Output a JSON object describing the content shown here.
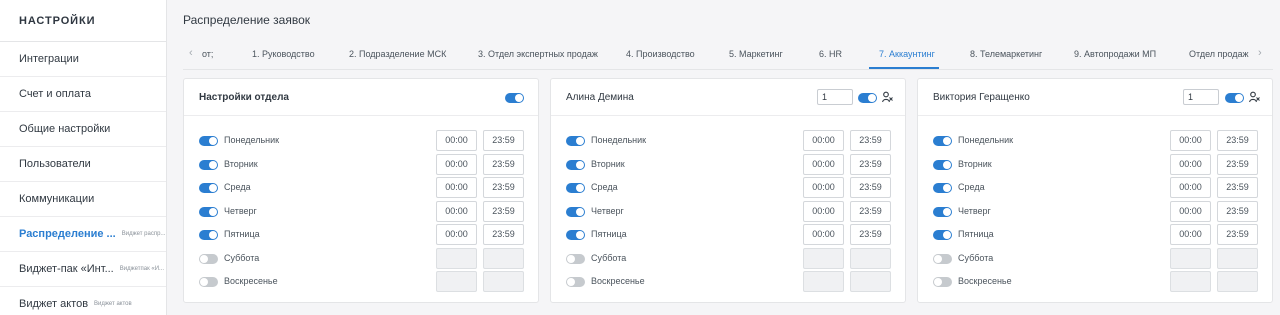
{
  "sidebar": {
    "title": "НАСТРОЙКИ",
    "items": [
      {
        "label": "Интеграции",
        "sub": ""
      },
      {
        "label": "Счет и оплата",
        "sub": ""
      },
      {
        "label": "Общие настройки",
        "sub": ""
      },
      {
        "label": "Пользователи",
        "sub": ""
      },
      {
        "label": "Коммуникации",
        "sub": ""
      },
      {
        "label": "Распределение ...",
        "sub": "Виджет распр...",
        "active": true
      },
      {
        "label": "Виджет-пак «Инт...",
        "sub": "Виджетпак «И..."
      },
      {
        "label": "Виджет актов",
        "sub": "Виджет актов"
      }
    ]
  },
  "header": {
    "title": "Распределение заявок"
  },
  "tabs": [
    {
      "label": "от;"
    },
    {
      "label": "1. Руководство"
    },
    {
      "label": "2. Подразделение МСК"
    },
    {
      "label": "3. Отдел экспертных продаж"
    },
    {
      "label": "4. Производство"
    },
    {
      "label": "5. Маркетинг"
    },
    {
      "label": "6. HR"
    },
    {
      "label": "7. Аккаунтинг",
      "active": true
    },
    {
      "label": "8. Телемаркетинг"
    },
    {
      "label": "9. Автопродажи МП"
    },
    {
      "label": "Отдел продаж"
    }
  ],
  "days": [
    "Понедельник",
    "Вторник",
    "Среда",
    "Четверг",
    "Пятница",
    "Суббота",
    "Воскресенье"
  ],
  "cards": [
    {
      "title": "Настройки отдела",
      "count": "",
      "schedule": [
        {
          "on": true,
          "from": "00:00",
          "to": "23:59"
        },
        {
          "on": true,
          "from": "00:00",
          "to": "23:59"
        },
        {
          "on": true,
          "from": "00:00",
          "to": "23:59"
        },
        {
          "on": true,
          "from": "00:00",
          "to": "23:59"
        },
        {
          "on": true,
          "from": "00:00",
          "to": "23:59"
        },
        {
          "on": false,
          "from": "",
          "to": ""
        },
        {
          "on": false,
          "from": "",
          "to": ""
        }
      ]
    },
    {
      "title": "Алина Демина",
      "count": "1",
      "schedule": [
        {
          "on": true,
          "from": "00:00",
          "to": "23:59"
        },
        {
          "on": true,
          "from": "00:00",
          "to": "23:59"
        },
        {
          "on": true,
          "from": "00:00",
          "to": "23:59"
        },
        {
          "on": true,
          "from": "00:00",
          "to": "23:59"
        },
        {
          "on": true,
          "from": "00:00",
          "to": "23:59"
        },
        {
          "on": false,
          "from": "",
          "to": ""
        },
        {
          "on": false,
          "from": "",
          "to": ""
        }
      ]
    },
    {
      "title": "Виктория Геращенко",
      "count": "1",
      "schedule": [
        {
          "on": true,
          "from": "00:00",
          "to": "23:59"
        },
        {
          "on": true,
          "from": "00:00",
          "to": "23:59"
        },
        {
          "on": true,
          "from": "00:00",
          "to": "23:59"
        },
        {
          "on": true,
          "from": "00:00",
          "to": "23:59"
        },
        {
          "on": true,
          "from": "00:00",
          "to": "23:59"
        },
        {
          "on": false,
          "from": "",
          "to": ""
        },
        {
          "on": false,
          "from": "",
          "to": ""
        }
      ]
    }
  ],
  "colors": {
    "accent": "#2b7ed1",
    "toggle_off": "#c6cace"
  }
}
